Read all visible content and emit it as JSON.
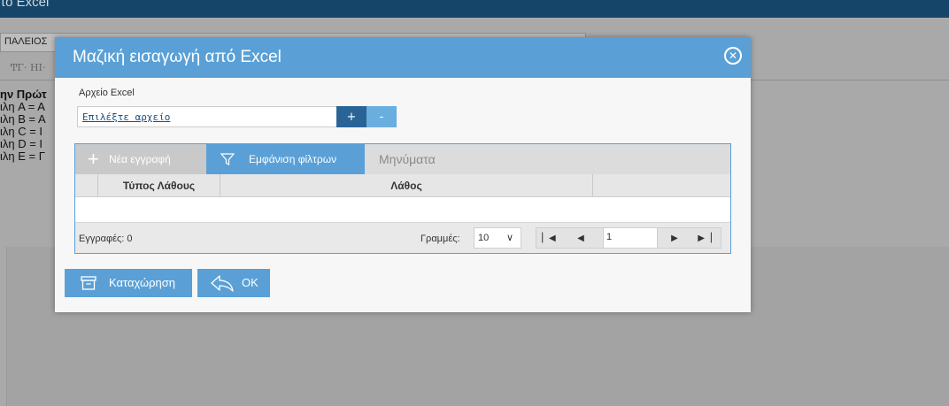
{
  "background": {
    "header_title": "πο Excel",
    "field_text": "ΠΑΛΕΙΟΣ",
    "toolbar_text": "ͲΓ· HI·",
    "text_lines": [
      {
        "text": "ην Πρώτ",
        "bold": true
      },
      {
        "text": "ιλη A = A",
        "bold": false
      },
      {
        "text": "ιλη B = A",
        "bold": false
      },
      {
        "text": "ιλη C = I",
        "bold": false
      },
      {
        "text": "ιλη D = I",
        "bold": false
      },
      {
        "text": "ιλη E = Γ",
        "bold": false
      }
    ]
  },
  "modal": {
    "title": "Μαζική εισαγωγή από Excel",
    "close_glyph": "✕",
    "file": {
      "label": "Αρχείο Excel",
      "placeholder": "Επιλέξτε αρχείο",
      "add_label": "+",
      "remove_label": "-"
    },
    "grid": {
      "toolbar": {
        "new_label": "Νέα εγγραφή",
        "new_glyph": "+",
        "filter_label": "Εμφάνιση φίλτρων",
        "messages_label": "Μηνύματα"
      },
      "columns": [
        "Τύπος Λάθους",
        "Λάθος"
      ],
      "footer": {
        "records": "Εγγραφές: 0",
        "rows_label": "Γραμμές:",
        "rows_value": "10",
        "page_value": "1"
      }
    },
    "buttons": {
      "save_label": "Καταχώρηση",
      "ok_label": "OK"
    }
  },
  "colors": {
    "accent": "#5aa0d6",
    "dark_blue": "#2a6496",
    "app_header": "#16456a"
  }
}
